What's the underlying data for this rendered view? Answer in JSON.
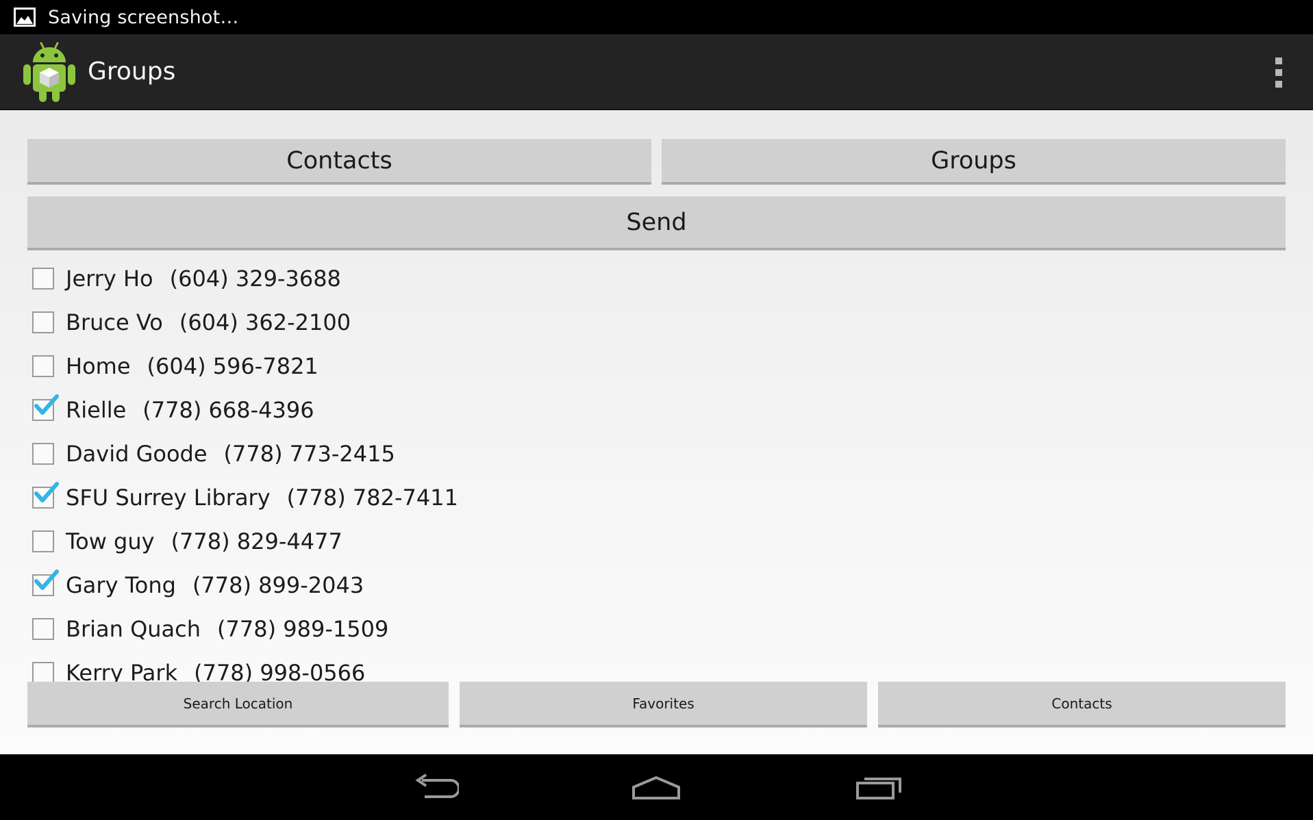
{
  "status_bar": {
    "notification_icon": "image-icon",
    "text": "Saving screenshot…"
  },
  "action_bar": {
    "app_icon": "android-app-icon",
    "title": "Groups",
    "overflow_icon": "overflow-menu-icon"
  },
  "top_buttons": {
    "contacts_label": "Contacts",
    "groups_label": "Groups",
    "send_label": "Send"
  },
  "contacts": [
    {
      "name": "Jerry Ho",
      "phone": "(604) 329-3688",
      "checked": false
    },
    {
      "name": "Bruce Vo",
      "phone": "(604) 362-2100",
      "checked": false
    },
    {
      "name": "Home",
      "phone": "(604) 596-7821",
      "checked": false
    },
    {
      "name": "Rielle",
      "phone": "(778) 668-4396",
      "checked": true
    },
    {
      "name": "David Goode",
      "phone": "(778) 773-2415",
      "checked": false
    },
    {
      "name": "SFU Surrey Library",
      "phone": "(778) 782-7411",
      "checked": true
    },
    {
      "name": "Tow guy",
      "phone": "(778) 829-4477",
      "checked": false
    },
    {
      "name": "Gary Tong",
      "phone": "(778) 899-2043",
      "checked": true
    },
    {
      "name": "Brian Quach",
      "phone": "(778) 989-1509",
      "checked": false
    },
    {
      "name": "Kerry Park",
      "phone": "(778) 998-0566",
      "checked": false
    }
  ],
  "bottom_buttons": {
    "search_location_label": "Search Location",
    "favorites_label": "Favorites",
    "contacts_label": "Contacts"
  },
  "nav_bar": {
    "back_icon": "back-icon",
    "home_icon": "home-icon",
    "recents_icon": "recent-apps-icon"
  },
  "colors": {
    "action_bar_bg": "#232323",
    "button_bg": "#d0d0d0",
    "check_accent": "#33b5e5"
  }
}
